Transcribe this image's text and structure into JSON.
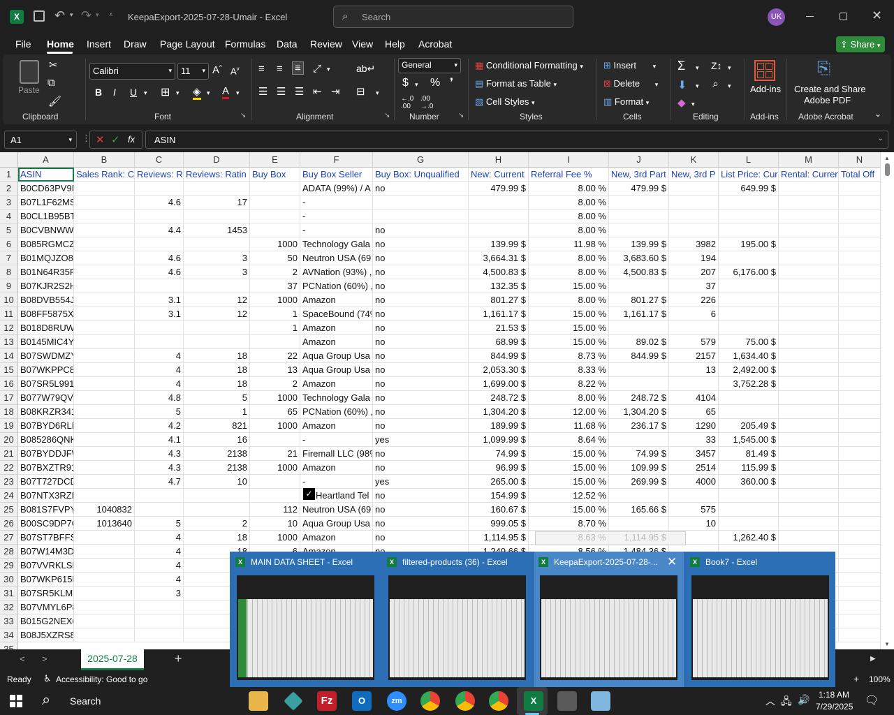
{
  "window": {
    "title": "KeepaExport-2025-07-28-Umair  -  Excel",
    "search_placeholder": "Search",
    "avatar_initials": "UK"
  },
  "menu": {
    "items": [
      "File",
      "Home",
      "Insert",
      "Draw",
      "Page Layout",
      "Formulas",
      "Data",
      "Review",
      "View",
      "Help",
      "Acrobat"
    ],
    "active": "Home",
    "share_label": "Share"
  },
  "ribbon": {
    "paste": "Paste",
    "font_name": "Calibri",
    "font_size": "11",
    "number_format": "General",
    "conditional_formatting": "Conditional Formatting",
    "format_as_table": "Format as Table",
    "cell_styles": "Cell Styles",
    "insert": "Insert",
    "delete": "Delete",
    "format": "Format",
    "addins": "Add-ins",
    "create_share_pdf_1": "Create and Share",
    "create_share_pdf_2": "Adobe PDF",
    "groups": [
      "Clipboard",
      "Font",
      "Alignment",
      "Number",
      "Styles",
      "Cells",
      "Editing",
      "Add-ins",
      "Adobe Acrobat"
    ]
  },
  "formula_bar": {
    "name_box": "A1",
    "formula": "ASIN"
  },
  "columns": [
    "A",
    "B",
    "C",
    "D",
    "E",
    "F",
    "G",
    "H",
    "I",
    "J",
    "K",
    "L",
    "M",
    "N"
  ],
  "header_row": [
    "ASIN",
    "Sales Rank: Cu",
    "Reviews: R",
    "Reviews: Ratin",
    "Buy Box",
    "Buy Box Seller",
    "Buy Box: Unqualified",
    "New: Current",
    "Referral Fee %",
    "New, 3rd Part",
    "New, 3rd P",
    "List Price: Cur",
    "Rental: Curren",
    "Total Off"
  ],
  "rows": [
    [
      "B0CD63PV9N",
      "",
      "",
      "",
      "",
      "ADATA (99%) / A",
      "no",
      "479.99 $",
      "8.00 %",
      "479.99 $",
      "",
      "649.99 $",
      "",
      ""
    ],
    [
      "B07L1F62MS",
      "",
      "4.6",
      "17",
      "",
      "-",
      "",
      "",
      "8.00 %",
      "",
      "",
      "",
      "",
      ""
    ],
    [
      "B0CL1B95BT",
      "",
      "",
      "",
      "",
      "-",
      "",
      "",
      "8.00 %",
      "",
      "",
      "",
      "",
      ""
    ],
    [
      "B0CVBNWW96",
      "",
      "4.4",
      "1453",
      "",
      "-",
      "no",
      "",
      "8.00 %",
      "",
      "",
      "",
      "",
      ""
    ],
    [
      "B085RGMCZ5",
      "",
      "",
      "",
      "1000",
      "Technology Gala",
      "no",
      "139.99 $",
      "11.98 %",
      "139.99 $",
      "3982",
      "195.00 $",
      "",
      ""
    ],
    [
      "B01MQJZO8S",
      "",
      "4.6",
      "3",
      "50",
      "Neutron USA (69",
      "no",
      "3,664.31 $",
      "8.00 %",
      "3,683.60 $",
      "194",
      "",
      "",
      ""
    ],
    [
      "B01N64R35P",
      "",
      "4.6",
      "3",
      "2",
      "AVNation (93%) ,",
      "no",
      "4,500.83 $",
      "8.00 %",
      "4,500.83 $",
      "207",
      "6,176.00 $",
      "",
      ""
    ],
    [
      "B07KJR2S2H",
      "",
      "",
      "",
      "37",
      "PCNation (60%) ,",
      "no",
      "132.35 $",
      "15.00 %",
      "",
      "37",
      "",
      "",
      ""
    ],
    [
      "B08DVB554J",
      "",
      "3.1",
      "12",
      "1000",
      "Amazon",
      "no",
      "801.27 $",
      "8.00 %",
      "801.27 $",
      "226",
      "",
      "",
      ""
    ],
    [
      "B08FF5875X",
      "",
      "3.1",
      "12",
      "1",
      "SpaceBound (74%",
      "no",
      "1,161.17 $",
      "15.00 %",
      "1,161.17 $",
      "6",
      "",
      "",
      ""
    ],
    [
      "B018D8RUW6",
      "",
      "",
      "",
      "1",
      "Amazon",
      "no",
      "21.53 $",
      "15.00 %",
      "",
      "",
      "",
      "",
      ""
    ],
    [
      "B0145MIC4Y",
      "",
      "",
      "",
      "",
      "Amazon",
      "no",
      "68.99 $",
      "15.00 %",
      "89.02 $",
      "579",
      "75.00 $",
      "",
      ""
    ],
    [
      "B07SWDMZYF",
      "",
      "4",
      "18",
      "22",
      "Aqua Group Usa",
      "no",
      "844.99 $",
      "8.73 %",
      "844.99 $",
      "2157",
      "1,634.40 $",
      "",
      ""
    ],
    [
      "B07WKPPC8P",
      "",
      "4",
      "18",
      "13",
      "Aqua Group Usa",
      "no",
      "2,053.30 $",
      "8.33 %",
      "",
      "13",
      "2,492.00 $",
      "",
      ""
    ],
    [
      "B07SR5L991",
      "",
      "4",
      "18",
      "2",
      "Amazon",
      "no",
      "1,699.00 $",
      "8.22 %",
      "",
      "",
      "3,752.28 $",
      "",
      ""
    ],
    [
      "B077W79QVQ",
      "",
      "4.8",
      "5",
      "1000",
      "Technology Gala",
      "no",
      "248.72 $",
      "8.00 %",
      "248.72 $",
      "4104",
      "",
      "",
      ""
    ],
    [
      "B08KRZR341",
      "",
      "5",
      "1",
      "65",
      "PCNation (60%) ,",
      "no",
      "1,304.20 $",
      "12.00 %",
      "1,304.20 $",
      "65",
      "",
      "",
      ""
    ],
    [
      "B07BYD6RLN",
      "",
      "4.2",
      "821",
      "1000",
      "Amazon",
      "no",
      "189.99 $",
      "11.68 %",
      "236.17 $",
      "1290",
      "205.49 $",
      "",
      ""
    ],
    [
      "B085286QNK",
      "",
      "4.1",
      "16",
      "",
      "-",
      "yes",
      "1,099.99 $",
      "8.64 %",
      "",
      "33",
      "1,545.00 $",
      "",
      ""
    ],
    [
      "B07BYDDJFW",
      "",
      "4.3",
      "2138",
      "21",
      "Firemall LLC (98%",
      "no",
      "74.99 $",
      "15.00 %",
      "74.99 $",
      "3457",
      "81.49 $",
      "",
      ""
    ],
    [
      "B07BXZTR91",
      "",
      "4.3",
      "2138",
      "1000",
      "Amazon",
      "no",
      "96.99 $",
      "15.00 %",
      "109.99 $",
      "2514",
      "115.99 $",
      "",
      ""
    ],
    [
      "B07T727DCD",
      "",
      "4.7",
      "10",
      "",
      "-",
      "yes",
      "265.00 $",
      "15.00 %",
      "269.99 $",
      "4000",
      "360.00 $",
      "",
      ""
    ],
    [
      "B07NTX3RZL",
      "",
      "",
      "",
      "",
      "Heartland Tel",
      "no",
      "154.99 $",
      "12.52 %",
      "",
      "",
      "",
      "",
      ""
    ],
    [
      "B081S7FVPY",
      "1040832",
      "",
      "",
      "112",
      "Neutron USA (69",
      "no",
      "160.67 $",
      "15.00 %",
      "165.66 $",
      "575",
      "",
      "",
      ""
    ],
    [
      "B00SC9DP7G",
      "1013640",
      "5",
      "2",
      "10",
      "Aqua Group Usa",
      "no",
      "999.05 $",
      "8.70 %",
      "",
      "10",
      "",
      "",
      ""
    ],
    [
      "B07ST7BFFS",
      "",
      "4",
      "18",
      "1000",
      "Amazon",
      "no",
      "1,114.95 $",
      "8.63 %",
      "1,114.95 $",
      "",
      "1,262.40 $",
      "",
      ""
    ],
    [
      "B07W14M3D5",
      "",
      "4",
      "18",
      "6",
      "Amazon",
      "no",
      "1,249.66 $",
      "8.56 %",
      "1,484.36 $",
      "",
      "",
      "",
      ""
    ],
    [
      "B07VVRKLSB",
      "",
      "4",
      "",
      "",
      "",
      "",
      "",
      "",
      "",
      "",
      "",
      "",
      ""
    ],
    [
      "B07WKP615L",
      "",
      "4",
      "",
      "",
      "",
      "",
      "",
      "",
      "",
      "",
      "",
      "",
      ""
    ],
    [
      "B07SR5KLMB",
      "",
      "3",
      "",
      "",
      "",
      "",
      "",
      "",
      "",
      "",
      "",
      "",
      ""
    ],
    [
      "B07VMYL6P8",
      "",
      "",
      "",
      "",
      "",
      "",
      "",
      "",
      "",
      "",
      "",
      "",
      ""
    ],
    [
      "B015G2NEX6",
      "",
      "",
      "",
      "",
      "",
      "",
      "",
      "",
      "",
      "",
      "",
      "",
      ""
    ],
    [
      "B08J5XZRS8",
      "",
      "",
      "",
      "",
      "",
      "",
      "",
      "",
      "",
      "",
      "",
      "",
      ""
    ]
  ],
  "row_numbers": [
    "1",
    "2",
    "3",
    "4",
    "5",
    "6",
    "7",
    "8",
    "9",
    "10",
    "11",
    "12",
    "13",
    "14",
    "15",
    "16",
    "17",
    "18",
    "19",
    "20",
    "21",
    "22",
    "23",
    "24",
    "25",
    "26",
    "27",
    "28",
    "29",
    "30",
    "31",
    "32",
    "33",
    "34",
    "35"
  ],
  "sheet_tab": "2025-07-28",
  "status": {
    "ready": "Ready",
    "accessibility": "Accessibility: Good to go",
    "zoom": "100%"
  },
  "taskbar_previews": [
    {
      "title": "MAIN DATA SHEET - Excel"
    },
    {
      "title": "filtered-products (36) - Excel"
    },
    {
      "title": "KeepaExport-2025-07-28-..."
    },
    {
      "title": "Book7 - Excel"
    }
  ],
  "taskbar": {
    "search_label": "Search",
    "time": "1:18 AM",
    "date": "7/29/2025"
  },
  "colors": {
    "excel_green": "#107c41",
    "share_green": "#2e8b3a",
    "header_text_blue": "#1a3fbf",
    "preview_blue": "#3873b5"
  }
}
